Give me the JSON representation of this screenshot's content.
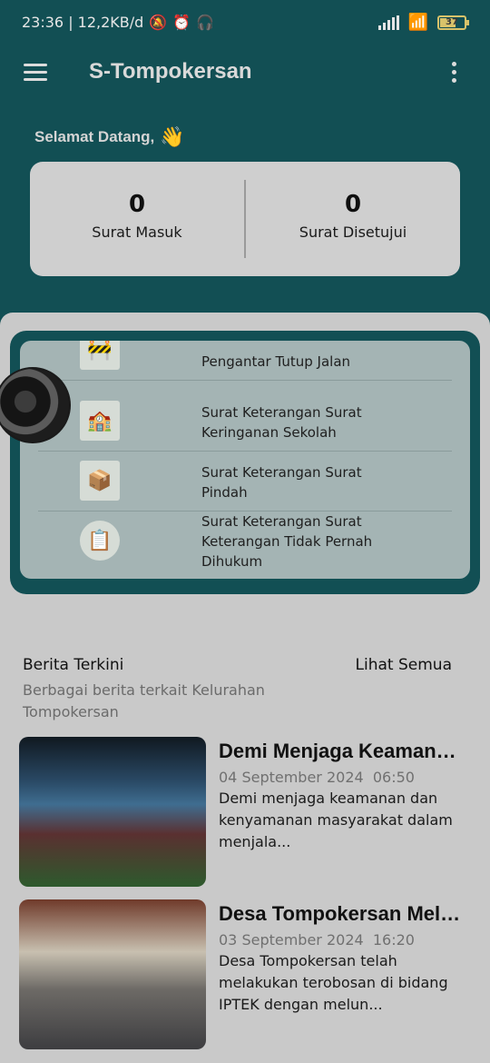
{
  "status_bar": {
    "left_text": "23:36 | 12,2KB/d",
    "battery": "37"
  },
  "app": {
    "title": "S-Tompokersan",
    "greeting": "Selamat Datang,",
    "greeting_emoji": "👋"
  },
  "stats": [
    {
      "value": "0",
      "label": "Surat Masuk"
    },
    {
      "value": "0",
      "label": "Surat Disetujui"
    }
  ],
  "services": [
    {
      "label": "Pengantar Tutup Jalan",
      "icon": "road-closure-icon"
    },
    {
      "label": "Surat Keterangan Surat Keringanan Sekolah",
      "icon": "school-relief-icon"
    },
    {
      "label": "Surat Keterangan Surat Pindah",
      "icon": "moving-box-icon"
    },
    {
      "label": "Surat Keterangan Surat Keterangan Tidak Pernah Dihukum",
      "icon": "record-icon"
    }
  ],
  "news": {
    "title": "Berita Terkini",
    "see_all": "Lihat Semua",
    "subtitle": "Berbagai berita terkait Kelurahan Tompokersan",
    "items": [
      {
        "headline": "Demi Menjaga Keamanan Dan Ken...",
        "date": "04 September 2024",
        "time": "06:50",
        "excerpt": "Demi menjaga keamanan dan kenyamanan masyarakat dalam menjala..."
      },
      {
        "headline": "Desa Tompokersan Melakukan Inovasi B...",
        "date": "03 September 2024",
        "time": "16:20",
        "excerpt": "Desa Tompokersan telah melakukan terobosan di bidang IPTEK dengan melun..."
      }
    ]
  }
}
